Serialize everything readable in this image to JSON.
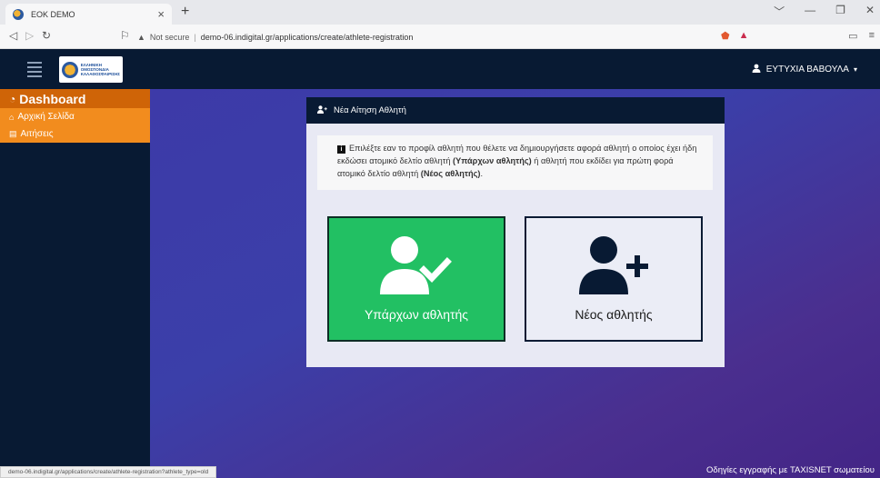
{
  "browser": {
    "tab_title": "ΕΟΚ DEMO",
    "tab_close": "×",
    "new_tab": "+",
    "security_label": "Not secure",
    "url": "demo-06.indigital.gr/applications/create/athlete-registration",
    "status_url": "demo-06.indigital.gr/applications/create/athlete-registration?athlete_type=old"
  },
  "navbar": {
    "logo_lines": [
      "ΕΛΛΗΝΙΚΗ",
      "ΟΜΟΣΠΟΝΔΙΑ",
      "ΚΑΛΑΘΟΣΦΑΙΡΙΣΗΣ"
    ],
    "user_name": "ΕΥΤΥΧΙΑ ΒΑΒΟΥΛΑ",
    "user_caret": "▾"
  },
  "sidebar": {
    "dashboard_label": "Dashboard",
    "items": [
      {
        "label": "Αρχική Σελίδα",
        "icon": "home-icon"
      },
      {
        "label": "Αιτήσεις",
        "icon": "document-icon"
      }
    ]
  },
  "card": {
    "header_title": "Νέα Αίτηση Αθλητή",
    "info": {
      "text_1": "Επιλέξτε εαν το προφίλ αθλητή που θέλετε να δημιουργήσετε αφορά αθλητή ο οποίος έχει ήδη εκδώσει ατομικό δελτίο αθλητή",
      "bold_1": "(Υπάρχων αθλητής)",
      "text_2": "ή αθλητή που εκδίδει για πρώτη φορά ατομικό δελτίο αθλητή",
      "bold_2": "(Νέος αθλητής)",
      "text_3": "."
    },
    "choices": {
      "existing_label": "Υπάρχων αθλητής",
      "new_label": "Νέος αθλητής"
    }
  },
  "footer": {
    "link_text": "Οδηγίες εγγραφής με TAXISNET σωματείου"
  },
  "colors": {
    "navy": "#081a33",
    "orange_dark": "#cf6407",
    "orange": "#f28c1e",
    "green": "#22c063"
  }
}
